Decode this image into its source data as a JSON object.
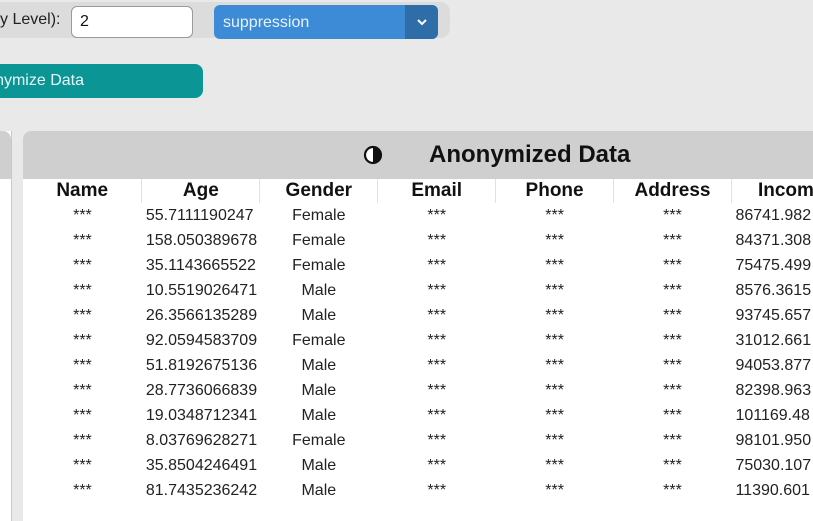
{
  "controls": {
    "level_label": "y Level):",
    "level_value": "2",
    "method_selected": "suppression"
  },
  "actions": {
    "anonymize_label": "nymize Data"
  },
  "panel": {
    "title": "Anonymized Data",
    "columns": [
      "Name",
      "Age",
      "Gender",
      "Email",
      "Phone",
      "Address",
      "Incom"
    ],
    "rows": [
      [
        "***",
        "55.7111190247",
        "Female",
        "***",
        "***",
        "***",
        "86741.982"
      ],
      [
        "***",
        "158.050389678",
        "Female",
        "***",
        "***",
        "***",
        "84371.308"
      ],
      [
        "***",
        "35.1143665522",
        "Female",
        "***",
        "***",
        "***",
        "75475.499"
      ],
      [
        "***",
        "10.5519026471",
        "Male",
        "***",
        "***",
        "***",
        "8576.3615"
      ],
      [
        "***",
        "26.3566135289",
        "Male",
        "***",
        "***",
        "***",
        "93745.657"
      ],
      [
        "***",
        "92.0594583709",
        "Female",
        "***",
        "***",
        "***",
        "31012.661"
      ],
      [
        "***",
        "51.8192675136",
        "Male",
        "***",
        "***",
        "***",
        "94053.877"
      ],
      [
        "***",
        "28.7736066839",
        "Male",
        "***",
        "***",
        "***",
        "82398.963"
      ],
      [
        "***",
        "19.0348712341",
        "Male",
        "***",
        "***",
        "***",
        "101169.48"
      ],
      [
        "***",
        "8.03769628271",
        "Female",
        "***",
        "***",
        "***",
        "98101.950"
      ],
      [
        "***",
        "35.8504246491",
        "Male",
        "***",
        "***",
        "***",
        "75030.107"
      ],
      [
        "***",
        "81.7435236242",
        "Male",
        "***",
        "***",
        "***",
        "11390.601"
      ]
    ]
  }
}
